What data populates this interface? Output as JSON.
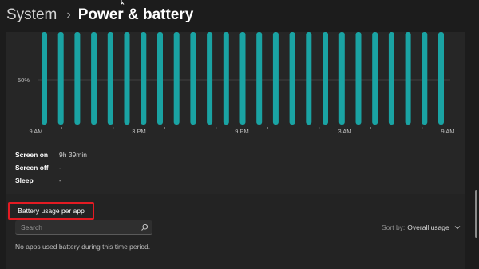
{
  "header": {
    "section": "System",
    "page": "Power & battery"
  },
  "chart_data": {
    "type": "bar",
    "ylabel_tick": "50%",
    "x_ticks": [
      "9 AM",
      "3 PM",
      "9 PM",
      "3 AM",
      "9 AM"
    ],
    "bar_count": 25,
    "values_percent": [
      100,
      100,
      100,
      100,
      100,
      100,
      100,
      100,
      100,
      100,
      100,
      100,
      100,
      100,
      100,
      100,
      100,
      100,
      100,
      100,
      100,
      100,
      100,
      100,
      100
    ],
    "ylim": [
      0,
      100
    ],
    "bar_color": "#1aa3a3"
  },
  "stats": [
    {
      "label": "Screen on",
      "value": "9h 39min"
    },
    {
      "label": "Screen off",
      "value": "-"
    },
    {
      "label": "Sleep",
      "value": "-"
    }
  ],
  "usage": {
    "title": "Battery usage per app",
    "search_placeholder": "Search",
    "sort_label": "Sort by:",
    "sort_value": "Overall usage",
    "empty_message": "No apps used battery during this time period."
  },
  "colors": {
    "highlight": "#e31b23",
    "accent": "#1aa3a3"
  }
}
